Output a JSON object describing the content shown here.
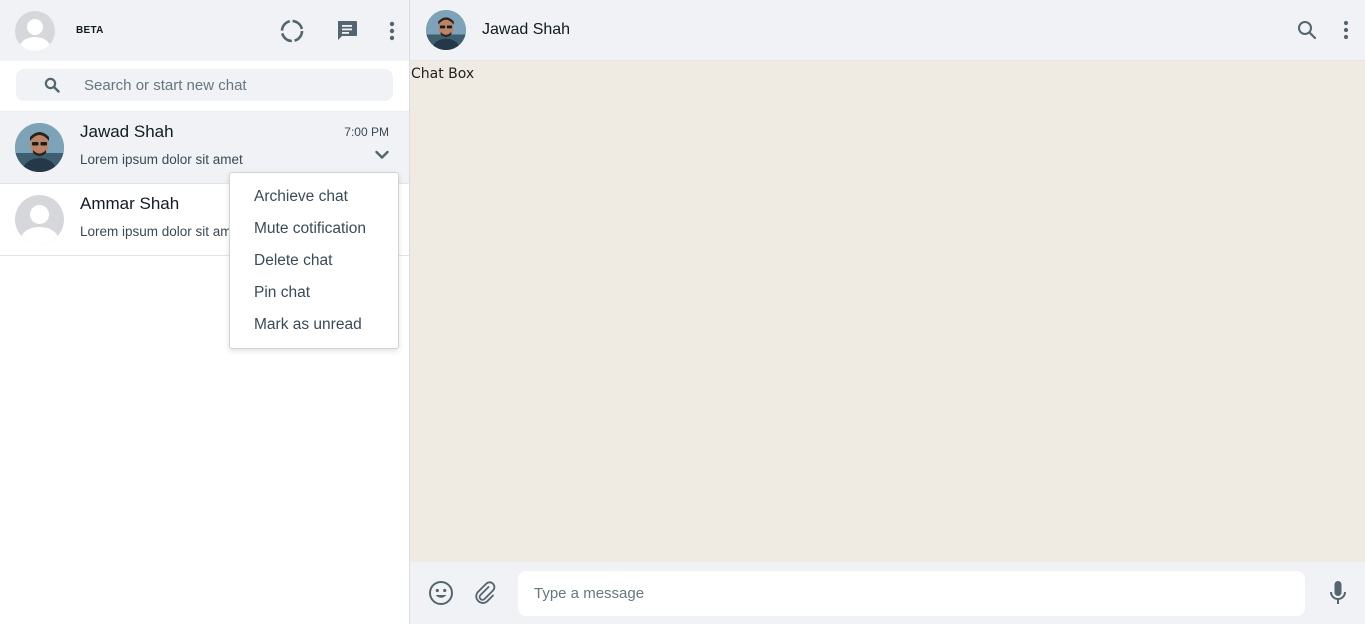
{
  "sidebar": {
    "header": {
      "beta_label": "BETA",
      "icons": [
        "status-icon",
        "new-chat-icon",
        "menu-icon"
      ]
    },
    "search": {
      "placeholder": "Search or start new chat"
    },
    "chats": [
      {
        "name": "Jawad Shah",
        "message": "Lorem ipsum dolor sit amet",
        "time": "7:00 PM"
      },
      {
        "name": "Ammar Shah",
        "message": "Lorem ipsum dolor sit amet",
        "time": ""
      }
    ],
    "context_menu": {
      "items": [
        "Archieve chat",
        "Mute cotification",
        "Delete chat",
        "Pin chat",
        "Mark as unread"
      ]
    }
  },
  "conversation": {
    "contact_name": "Jawad Shah",
    "chatbox_label": "Chat Box",
    "composer": {
      "placeholder": "Type a message"
    }
  },
  "colors": {
    "panel": "#f0f2f5",
    "chat_background": "#efeae2",
    "icon": "#54656f"
  }
}
